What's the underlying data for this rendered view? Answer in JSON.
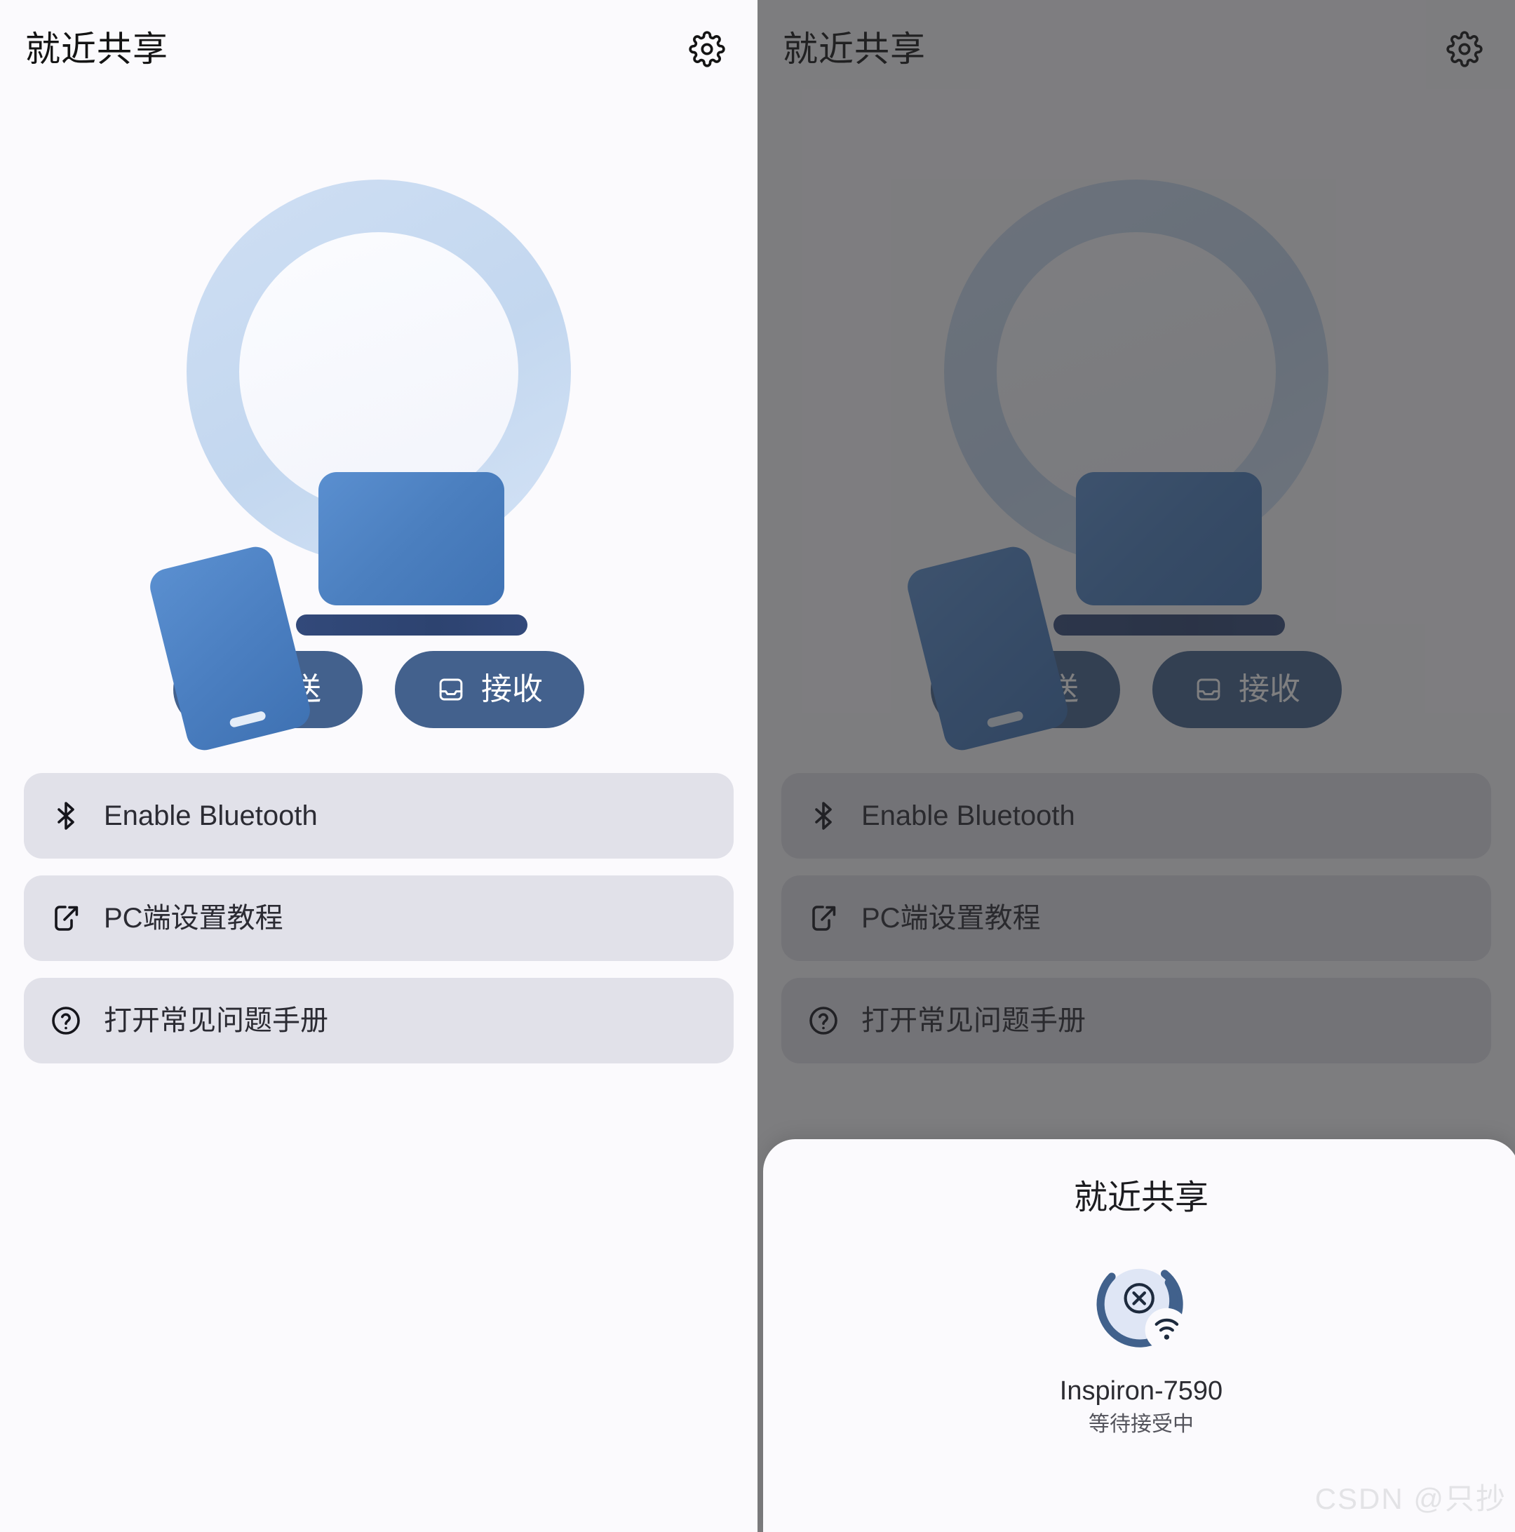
{
  "app": {
    "title": "就近共享",
    "settings_icon": "gear-icon"
  },
  "hero": {
    "illustration_icon": "laptop-and-phone-illustration",
    "ring_color": "#c7daf1",
    "inner_color": "#f4f5fa",
    "device_color": "#4b7fbf",
    "base_color": "#2e4470"
  },
  "actions": {
    "send": {
      "label": "发送",
      "icon": "upload-icon"
    },
    "receive": {
      "label": "接收",
      "icon": "inbox-icon"
    },
    "button_color": "#43618d"
  },
  "rows": [
    {
      "label": "Enable Bluetooth",
      "icon": "bluetooth-icon"
    },
    {
      "label": "PC端设置教程",
      "icon": "external-link-icon"
    },
    {
      "label": "打开常见问题手册",
      "icon": "question-circle-icon"
    }
  ],
  "row_color": "#e1e1e9",
  "sheet": {
    "title": "就近共享",
    "device": {
      "name": "Inspiron-7590",
      "status": "等待接受中",
      "icon": "device-scanning-icon",
      "badge_icon": "wifi-icon",
      "close_icon": "close-circle-icon",
      "arc_color": "#41618c"
    }
  },
  "overlay": {
    "scrim_color": "#2a2a2c"
  },
  "watermark": {
    "text": "CSDN @只抄"
  }
}
